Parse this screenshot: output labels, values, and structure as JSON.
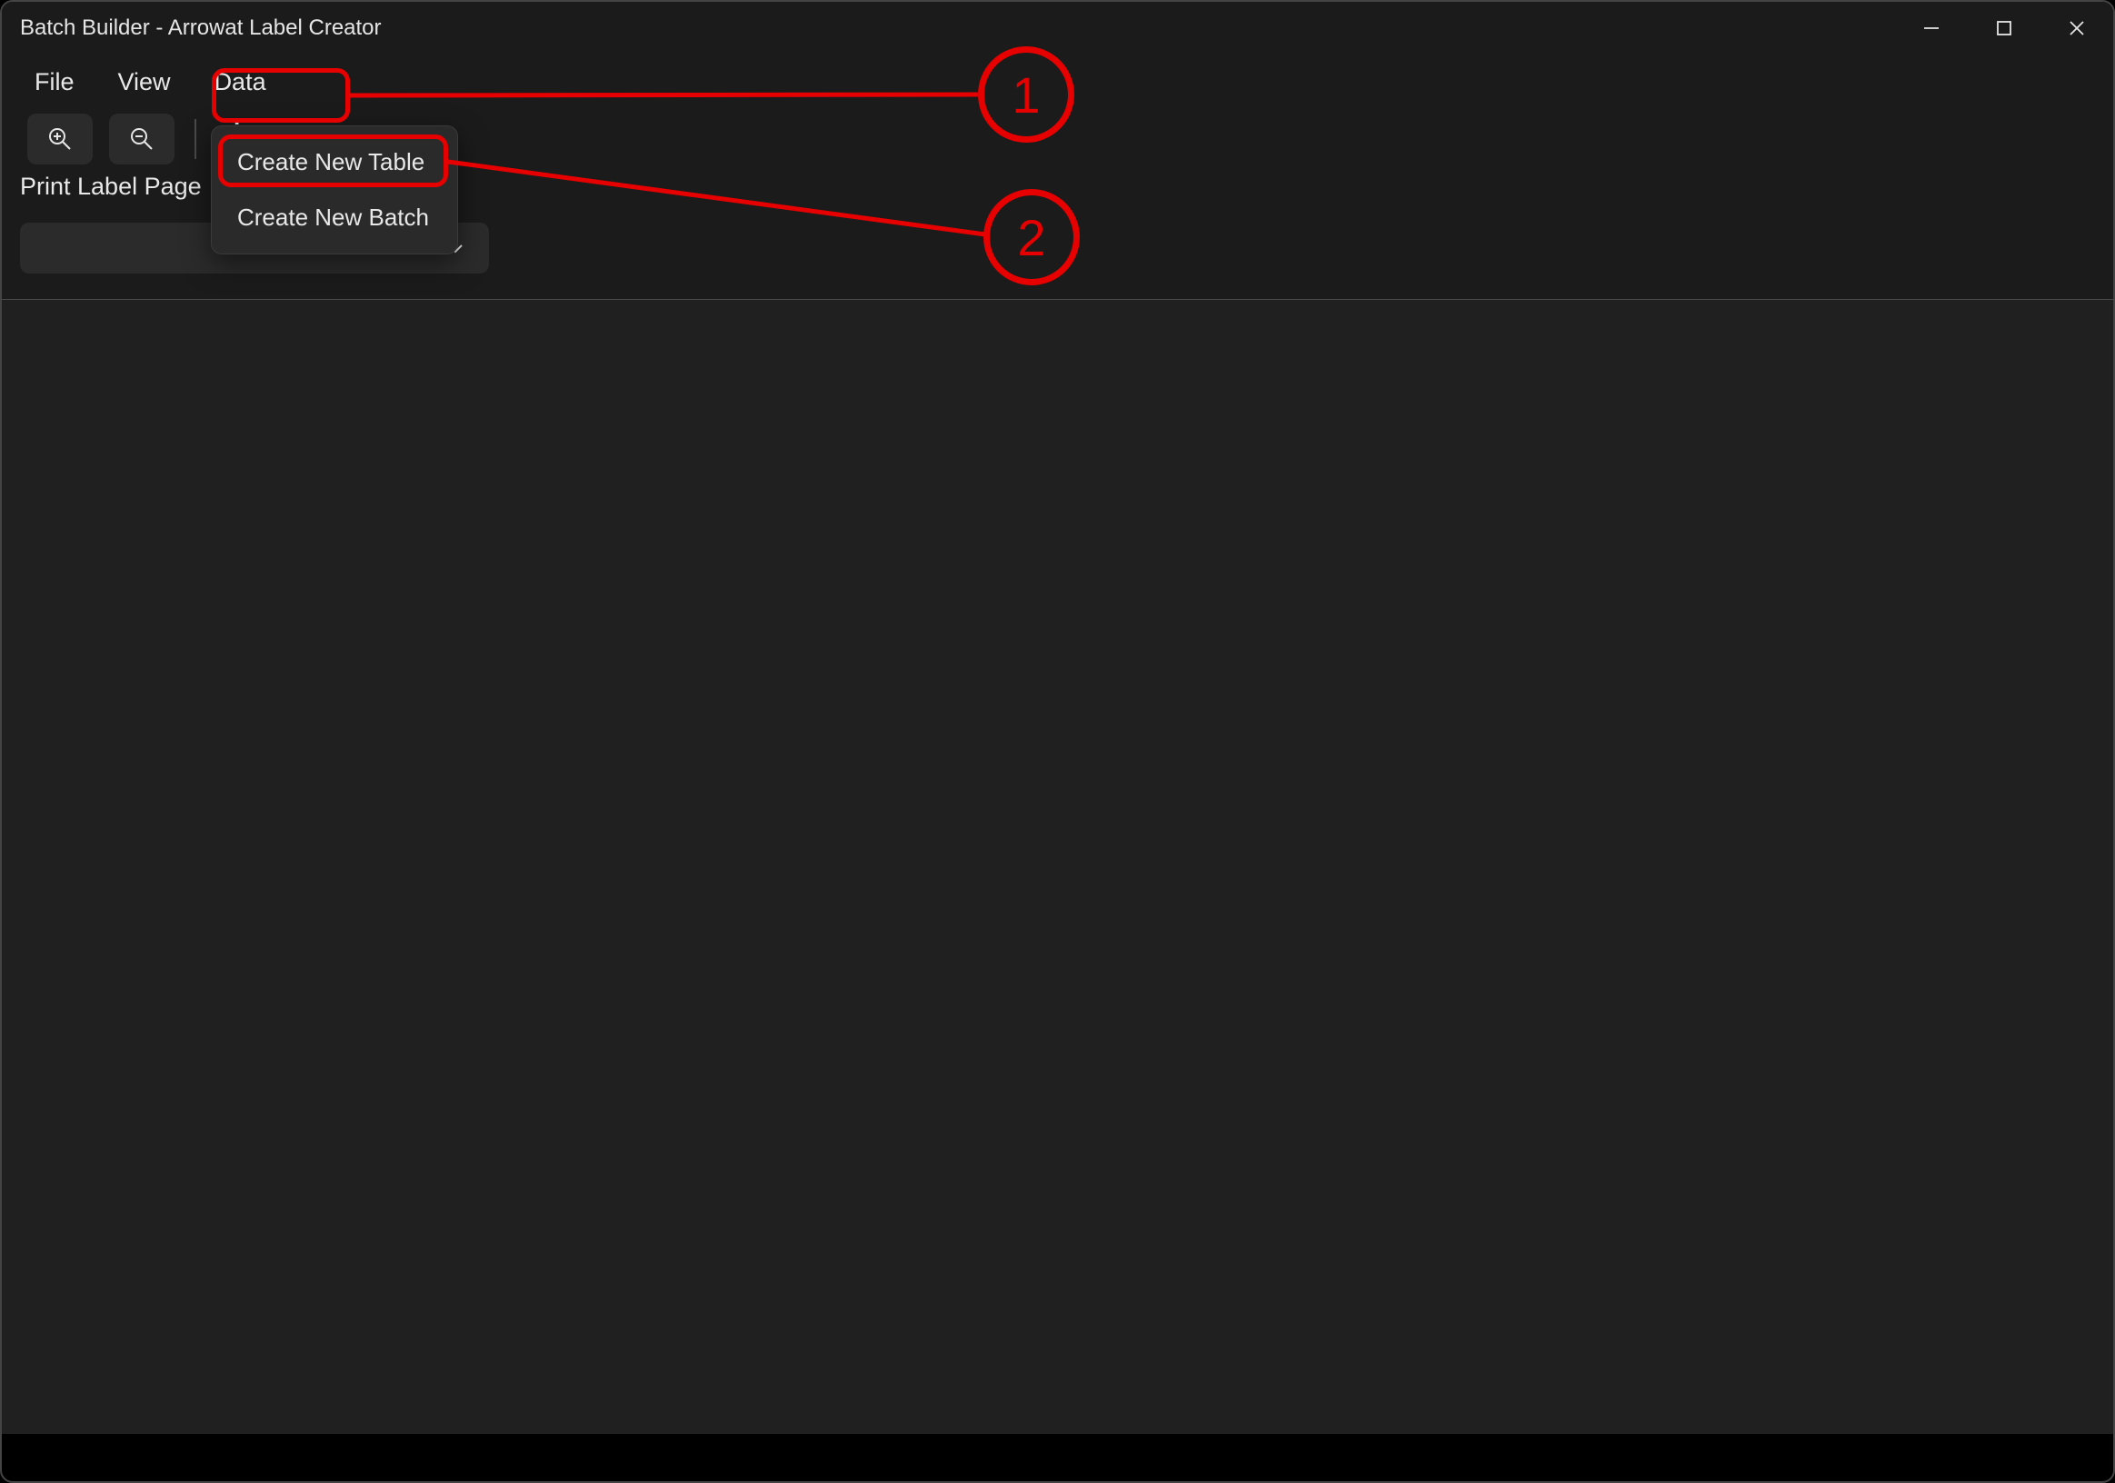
{
  "window": {
    "title": "Batch Builder - Arrowat Label Creator"
  },
  "menubar": {
    "items": [
      {
        "label": "File"
      },
      {
        "label": "View"
      },
      {
        "label": "Data"
      }
    ]
  },
  "toolbar": {
    "heading_behind": "jes"
  },
  "panel": {
    "print_label_page": "Print Label Page",
    "dropdown_value": ""
  },
  "context_menu": {
    "items": [
      {
        "label": "Create New Table"
      },
      {
        "label": "Create New Batch"
      }
    ]
  },
  "annotations": {
    "callout_1": "1",
    "callout_2": "2"
  }
}
